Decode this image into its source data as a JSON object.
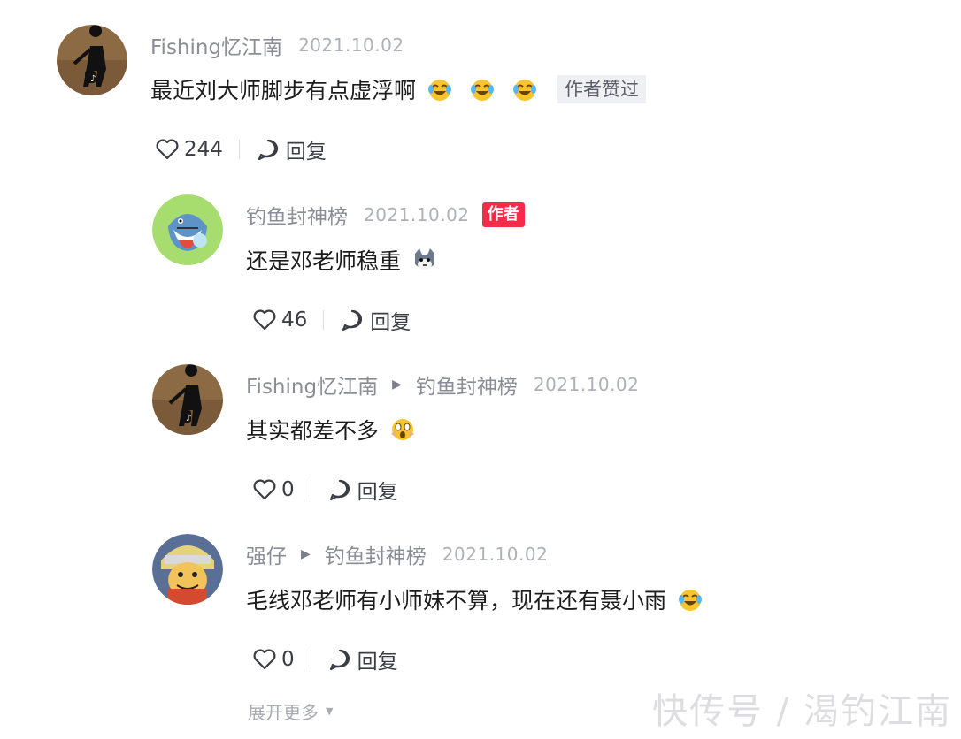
{
  "comments": [
    {
      "username": "Fishing忆江南",
      "date": "2021.10.02",
      "text": "最近刘大师脚步有点虚浮啊",
      "liked_badge": "作者赞过",
      "likes": "244",
      "reply_label": "回复"
    },
    {
      "username": "钓鱼封神榜",
      "date": "2021.10.02",
      "author_badge": "作者",
      "text": "还是邓老师稳重",
      "likes": "46",
      "reply_label": "回复"
    },
    {
      "username": "Fishing忆江南",
      "reply_to": "钓鱼封神榜",
      "date": "2021.10.02",
      "text": "其实都差不多",
      "likes": "0",
      "reply_label": "回复"
    },
    {
      "username": "强仔",
      "reply_to": "钓鱼封神榜",
      "date": "2021.10.02",
      "text": "毛线邓老师有小师妹不算，现在还有聂小雨",
      "likes": "0",
      "reply_label": "回复"
    }
  ],
  "expand_more": "展开更多",
  "watermark": "快传号 / 渴钓江南",
  "colors": {
    "author_badge": "#f32c4a",
    "meta_gray": "#8a8d96"
  },
  "icons": [
    "heart-icon",
    "comment-bubble-icon",
    "laugh-cry-emoji",
    "cat-emoji",
    "shocked-emoji",
    "chevron-down-icon"
  ]
}
